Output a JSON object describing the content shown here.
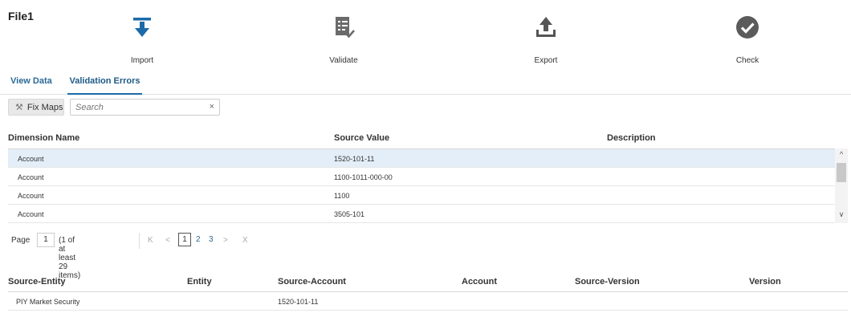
{
  "title": "File1",
  "workflow": {
    "import": {
      "label": "Import",
      "icon": "import-arrow-icon"
    },
    "validate": {
      "label": "Validate",
      "icon": "validate-document-icon"
    },
    "export": {
      "label": "Export",
      "icon": "export-upload-icon"
    },
    "check": {
      "label": "Check",
      "icon": "check-circle-icon"
    }
  },
  "tabs": [
    {
      "label": "View Data",
      "active": false
    },
    {
      "label": "Validation Errors",
      "active": true
    }
  ],
  "toolbar": {
    "fix_maps_label": "Fix Maps",
    "search_placeholder": "Search",
    "clear_glyph": "×"
  },
  "grid": {
    "columns": [
      "Dimension Name",
      "Source Value",
      "Description"
    ],
    "rows": [
      {
        "dimension": "Account",
        "source_value": "1520-101-11",
        "description": "",
        "selected": true
      },
      {
        "dimension": "Account",
        "source_value": "1100-1011-000-00",
        "description": "",
        "selected": false
      },
      {
        "dimension": "Account",
        "source_value": "1100",
        "description": "",
        "selected": false
      },
      {
        "dimension": "Account",
        "source_value": "3505-101",
        "description": "",
        "selected": false
      }
    ]
  },
  "pager": {
    "page_label": "Page",
    "page_value": "1",
    "summary": "(1 of at least 29 items)",
    "pages": [
      "1",
      "2",
      "3"
    ],
    "first": "K",
    "prev": "<",
    "next": ">",
    "last": "X"
  },
  "grid2": {
    "columns": [
      "Source-Entity",
      "Entity",
      "Source-Account",
      "Account",
      "Source-Version",
      "Version"
    ],
    "rows": [
      {
        "source_entity": "PIY Market Security",
        "entity": "",
        "source_account": "1520-101-11",
        "account": "",
        "source_version": "",
        "version": ""
      }
    ]
  },
  "colors": {
    "accent": "#1c6aa8",
    "selected_row": "#e4eef8",
    "icon_dark": "#5b5b5b"
  }
}
